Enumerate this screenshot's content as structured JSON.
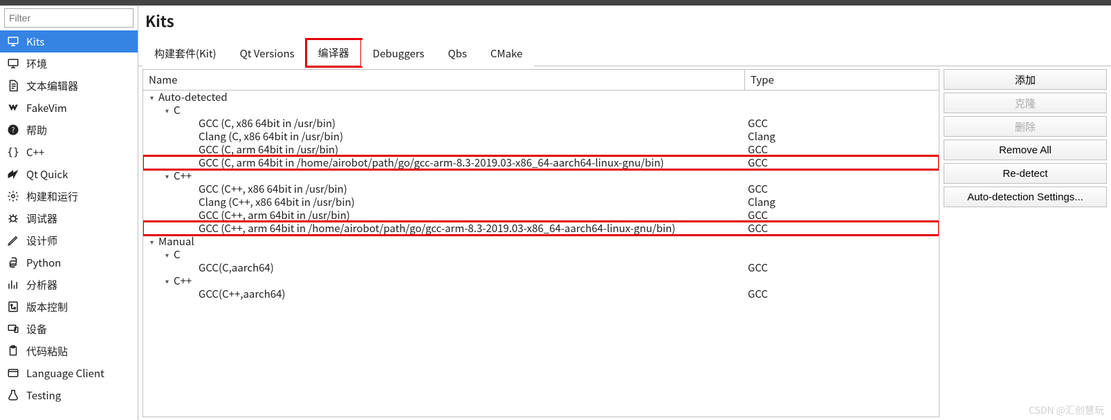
{
  "filter_placeholder": "Filter",
  "page_title": "Kits",
  "sidebar": {
    "items": [
      {
        "label": "Kits",
        "icon": "monitor-icon",
        "selected": true
      },
      {
        "label": "环境",
        "icon": "monitor-icon"
      },
      {
        "label": "文本编辑器",
        "icon": "document-icon"
      },
      {
        "label": "FakeVim",
        "icon": "fakevim-icon"
      },
      {
        "label": "帮助",
        "icon": "help-icon"
      },
      {
        "label": "C++",
        "icon": "braces-icon"
      },
      {
        "label": "Qt Quick",
        "icon": "qtquick-icon"
      },
      {
        "label": "构建和运行",
        "icon": "gears-icon"
      },
      {
        "label": "调试器",
        "icon": "bug-icon"
      },
      {
        "label": "设计师",
        "icon": "pencil-icon"
      },
      {
        "label": "Python",
        "icon": "python-icon"
      },
      {
        "label": "分析器",
        "icon": "analyzer-icon"
      },
      {
        "label": "版本控制",
        "icon": "vcs-icon"
      },
      {
        "label": "设备",
        "icon": "device-icon"
      },
      {
        "label": "代码粘贴",
        "icon": "paste-icon"
      },
      {
        "label": "Language Client",
        "icon": "language-icon"
      },
      {
        "label": "Testing",
        "icon": "testing-icon"
      }
    ]
  },
  "tabs": [
    {
      "label": "构建套件(Kit)"
    },
    {
      "label": "Qt Versions"
    },
    {
      "label": "编译器",
      "active": true,
      "highlight": true
    },
    {
      "label": "Debuggers"
    },
    {
      "label": "Qbs"
    },
    {
      "label": "CMake"
    }
  ],
  "columns": {
    "name": "Name",
    "type": "Type"
  },
  "tree": [
    {
      "name": "Auto-detected",
      "depth": 0,
      "expand": true
    },
    {
      "name": "C",
      "depth": 1,
      "expand": true
    },
    {
      "name": "GCC (C, x86 64bit in /usr/bin)",
      "type": "GCC",
      "depth": 2
    },
    {
      "name": "Clang (C, x86 64bit in /usr/bin)",
      "type": "Clang",
      "depth": 2
    },
    {
      "name": "GCC (C, arm 64bit in /usr/bin)",
      "type": "GCC",
      "depth": 2
    },
    {
      "name": "GCC (C, arm 64bit in /home/airobot/path/go/gcc-arm-8.3-2019.03-x86_64-aarch64-linux-gnu/bin)",
      "type": "GCC",
      "depth": 2,
      "highlight": true
    },
    {
      "name": "C++",
      "depth": 1,
      "expand": true
    },
    {
      "name": "GCC (C++, x86 64bit in /usr/bin)",
      "type": "GCC",
      "depth": 2
    },
    {
      "name": "Clang (C++, x86 64bit in /usr/bin)",
      "type": "Clang",
      "depth": 2
    },
    {
      "name": "GCC (C++, arm 64bit in /usr/bin)",
      "type": "GCC",
      "depth": 2
    },
    {
      "name": "GCC (C++, arm 64bit in /home/airobot/path/go/gcc-arm-8.3-2019.03-x86_64-aarch64-linux-gnu/bin)",
      "type": "GCC",
      "depth": 2,
      "highlight": true
    },
    {
      "name": "Manual",
      "depth": 0,
      "expand": true
    },
    {
      "name": "C",
      "depth": 1,
      "expand": true
    },
    {
      "name": "GCC(C,aarch64)",
      "type": "GCC",
      "depth": 2
    },
    {
      "name": "C++",
      "depth": 1,
      "expand": true
    },
    {
      "name": "GCC(C++,aarch64)",
      "type": "GCC",
      "depth": 2
    }
  ],
  "actions": {
    "add": "添加",
    "clone": "克隆",
    "delete": "删除",
    "remove_all": "Remove All",
    "redetect": "Re-detect",
    "auto_settings": "Auto-detection Settings..."
  },
  "watermark": "CSDN @汇创慧玩"
}
